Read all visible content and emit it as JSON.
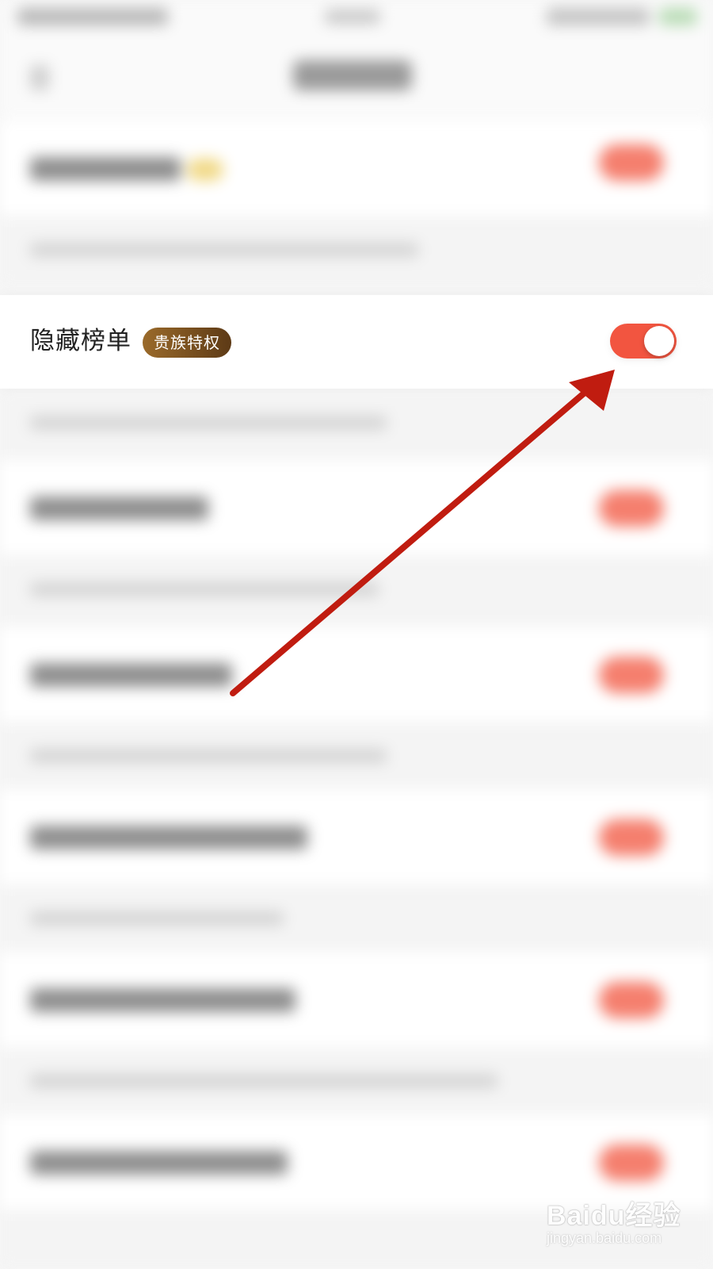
{
  "setting": {
    "label": "隐藏榜单",
    "badge": "贵族特权",
    "toggle_on": true
  },
  "colors": {
    "toggle_on": "#f25540",
    "badge_start": "#9a6a2a",
    "badge_end": "#5d3a16",
    "arrow": "#c01c10"
  },
  "watermark": {
    "text": "Baidu经验",
    "sub": "jingyan.baidu.com"
  }
}
